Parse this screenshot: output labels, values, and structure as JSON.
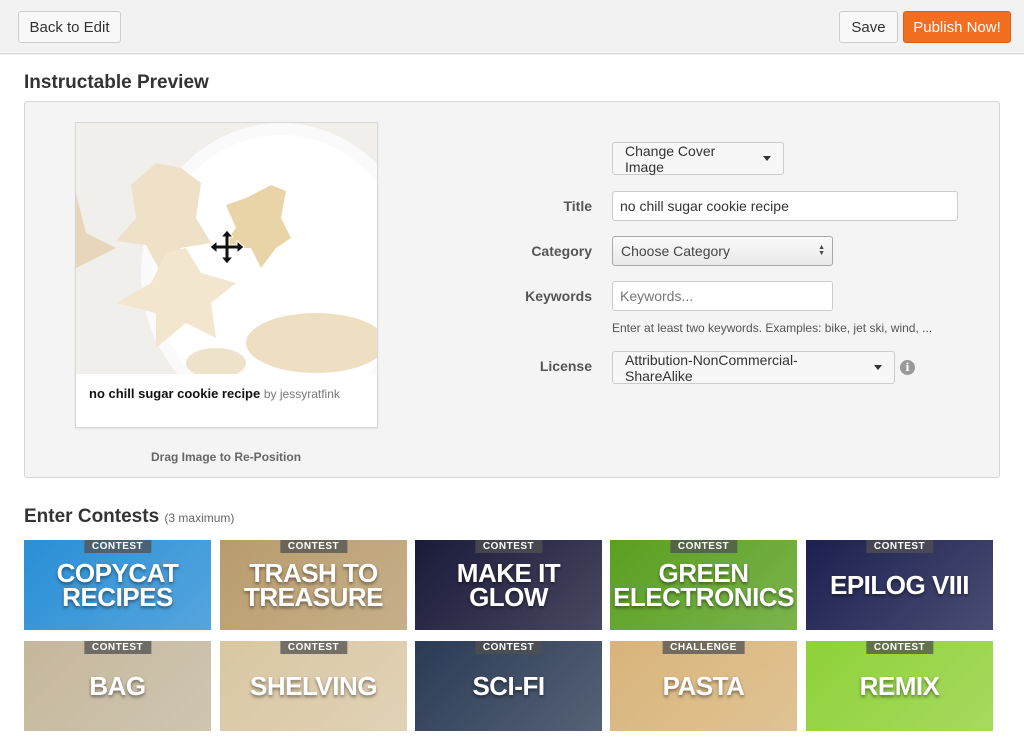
{
  "toolbar": {
    "back_label": "Back to Edit",
    "save_label": "Save",
    "publish_label": "Publish Now!",
    "publish_color": "#f26f21"
  },
  "preview": {
    "heading": "Instructable Preview",
    "card_title": "no chill sugar cookie recipe",
    "card_by": "by jessyratfink",
    "drag_hint": "Drag Image to Re-Position",
    "move_icon": "move-arrows-icon"
  },
  "form": {
    "change_cover_label": "Change Cover Image",
    "title_label": "Title",
    "title_value": "no chill sugar cookie recipe",
    "category_label": "Category",
    "category_value": "Choose Category",
    "keywords_label": "Keywords",
    "keywords_placeholder": "Keywords...",
    "keywords_hint": "Enter at least two keywords. Examples: bike, jet ski, wind, ...",
    "license_label": "License",
    "license_value": "Attribution-NonCommercial-ShareAlike",
    "info_icon": "info-icon"
  },
  "contests": {
    "heading": "Enter Contests",
    "limit_note": "(3 maximum)",
    "items": [
      {
        "tag": "CONTEST",
        "name": "COPYCAT RECIPES",
        "color": "#2a8fd6"
      },
      {
        "tag": "CONTEST",
        "name": "TRASH TO TREASURE",
        "color": "#b89c6c"
      },
      {
        "tag": "CONTEST",
        "name": "MAKE IT GLOW",
        "color": "#1a1a3a"
      },
      {
        "tag": "CONTEST",
        "name": "GREEN ELECTRONICS",
        "color": "#5aa020"
      },
      {
        "tag": "CONTEST",
        "name": "EPILOG VIII",
        "color": "#1c2050"
      },
      {
        "tag": "CONTEST",
        "name": "BAG",
        "color": "#c4b79c"
      },
      {
        "tag": "CONTEST",
        "name": "SHELVING",
        "color": "#d9c7a3"
      },
      {
        "tag": "CONTEST",
        "name": "SCI-FI",
        "color": "#2b3a55"
      },
      {
        "tag": "CHALLENGE",
        "name": "PASTA",
        "color": "#d8b47a"
      },
      {
        "tag": "CONTEST",
        "name": "REMIX",
        "color": "#8fd138"
      }
    ]
  }
}
